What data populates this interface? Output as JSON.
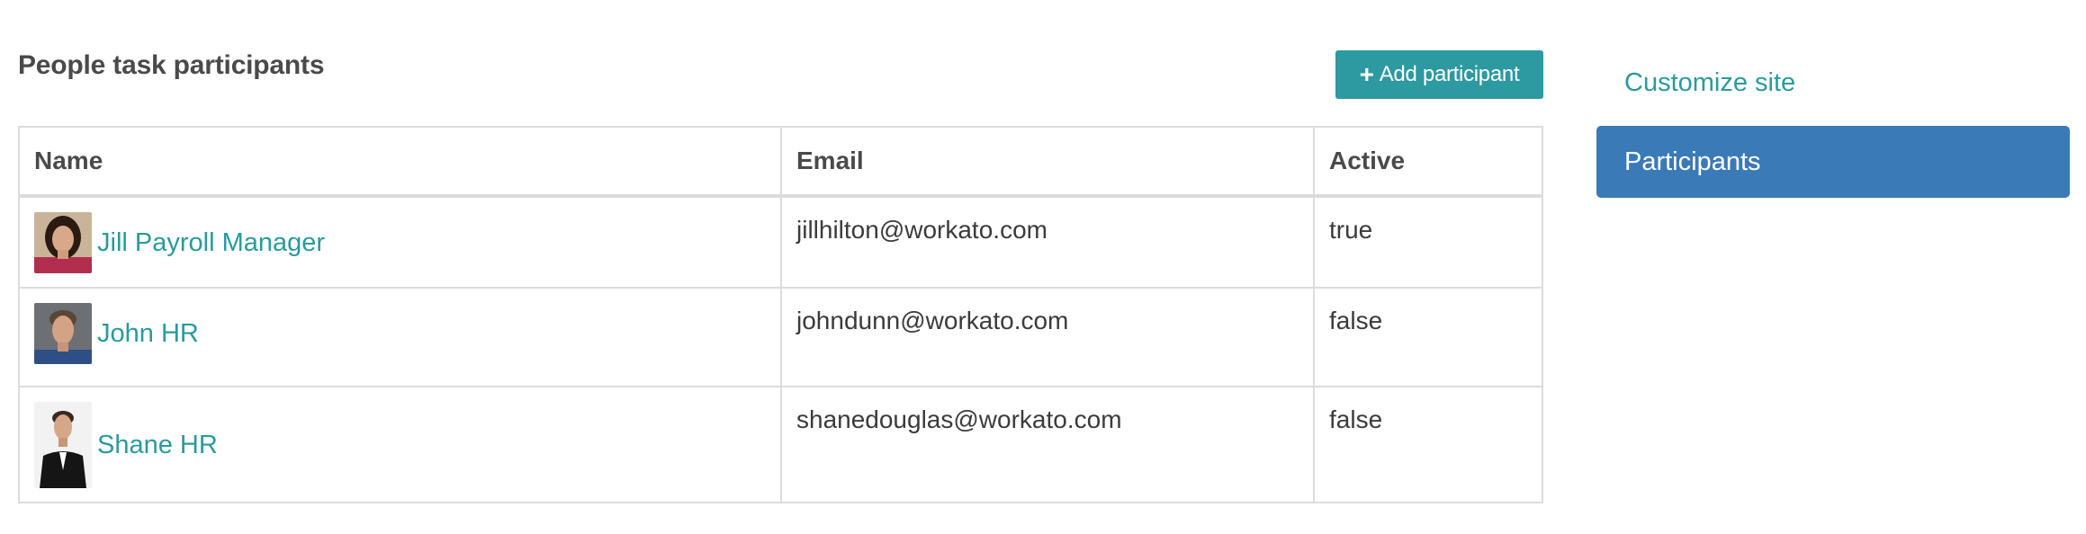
{
  "page": {
    "title": "People task participants",
    "add_button_label": "Add participant",
    "add_button_icon": "plus-icon"
  },
  "table": {
    "headers": [
      "Name",
      "Email",
      "Active"
    ],
    "rows": [
      {
        "name": "Jill Payroll Manager",
        "email": "jillhilton@workato.com",
        "active": "true"
      },
      {
        "name": "John HR",
        "email": "johndunn@workato.com",
        "active": "false"
      },
      {
        "name": "Shane HR",
        "email": "shanedouglas@workato.com",
        "active": "false"
      }
    ]
  },
  "sidebar": {
    "items": [
      {
        "label": "Customize site"
      },
      {
        "label": "Participants"
      }
    ]
  },
  "colors": {
    "accent_teal": "#2c9aa0",
    "link_teal": "#2a9a9d",
    "active_blue": "#3a7ab7",
    "border": "#dcdcdc"
  }
}
